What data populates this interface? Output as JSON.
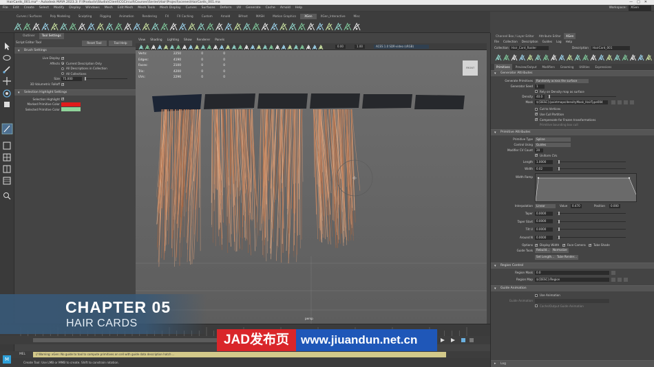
{
  "window": {
    "title": "HairCards_001.ma* - Autodesk MAYA 2023.3: F:\\Products\\Studio\\Client\\CGCircuit\\Courses\\Series\\Hair\\Project\\scenes\\HairCards_001.ma",
    "controls": [
      "—",
      "□",
      "✕"
    ]
  },
  "menubar": {
    "items": [
      "File",
      "Edit",
      "Create",
      "Select",
      "Modify",
      "Display",
      "Windows",
      "Mesh",
      "Edit Mesh",
      "Mesh Tools",
      "Mesh Display",
      "Curves",
      "Surfaces",
      "Deform",
      "UV",
      "Generate",
      "Cache",
      "Arnold",
      "Help"
    ],
    "workspace_label": "Workspace:",
    "workspace_value": "XGen"
  },
  "shelf": {
    "tabs": [
      "Curves / Surfaces",
      "Poly Modeling",
      "Sculpting",
      "Rigging",
      "Animation",
      "Rendering",
      "FX",
      "FX Caching",
      "Custom",
      "Arnold",
      "Bifrost",
      "MASH",
      "Motion Graphics",
      "XGen",
      "XGen_Interactive",
      "Misc"
    ],
    "active_tab": "XGen"
  },
  "tool_settings": {
    "tabs": [
      "Outliner",
      "Tool Settings"
    ],
    "active_tab": "Tool Settings",
    "tool_name": "Script Editor Tool",
    "reset_label": "Reset Tool",
    "help_label": "Tool Help",
    "brush_settings": "Brush Settings",
    "rows": {
      "live_display_label": "Live Display",
      "affects_label": "Affects",
      "affects_opt1": "Current Description Only",
      "affects_opt2": "All Descriptions in Collection",
      "affects_opt3": "All Collections",
      "size_label": "Size",
      "size_value": "75.000",
      "volume_label": "3D Volumetric Falloff"
    },
    "selection_highlight": "Selection Highlight Settings",
    "highlight_rows": {
      "sel_highlight_label": "Selection Highlight",
      "marked_label": "Marked Primitive Color",
      "selected_label": "Selected Primitive Color"
    }
  },
  "viewport": {
    "menu": [
      "View",
      "Shading",
      "Lighting",
      "Show",
      "Renderer",
      "Panels"
    ],
    "toolbar_values": [
      "0.00",
      "1.00"
    ],
    "color_space": "ACES 1.0 SDR-video (sRGB)",
    "hud": [
      {
        "k": "Verts:",
        "v1": "2250",
        "v2": "0",
        "v3": "0"
      },
      {
        "k": "Edges:",
        "v1": "4190",
        "v2": "0",
        "v3": "0"
      },
      {
        "k": "Faces:",
        "v1": "2100",
        "v2": "0",
        "v3": "0"
      },
      {
        "k": "Tris:",
        "v1": "4200",
        "v2": "0",
        "v3": "0"
      },
      {
        "k": "UVs:",
        "v1": "2296",
        "v2": "0",
        "v3": "0"
      }
    ],
    "viewcube_label": "FRONT",
    "camera_label": "persp"
  },
  "overlay": {
    "chapter": "CHAPTER 05",
    "subtitle": "HAIR CARDS"
  },
  "watermark": {
    "brand": "JAD发布页",
    "url": "www.jiuandun.net.cn"
  },
  "command_line": {
    "lang": "MEL",
    "result": "// Warning: xGen: No guide to tool to compute primitives on cell with guide data description hatch ..."
  },
  "help_line": {
    "text": "Create Tool: Use LMB or MMB to create. Shift to constrain rotation."
  },
  "right_panel": {
    "tabs": [
      "Channel Box / Layer Editor",
      "Attribute Editor",
      "XGen"
    ],
    "active_tab": "XGen",
    "menu": [
      "File",
      "Collection",
      "Description",
      "Guides",
      "Log",
      "Help"
    ],
    "collection_label": "Collection",
    "collection_value": "Hair_Card_Raider",
    "description_label": "Description",
    "description_value": "HairCard_001",
    "subtabs": [
      "Primitives",
      "Preview/Output",
      "Modifiers",
      "Grooming",
      "Utilities",
      "Expressions"
    ],
    "active_subtab": "Primitives",
    "generator": {
      "title": "Generator Attributes",
      "primitive_label": "Generate Primitives",
      "primitive_value": "Randomly across the surface",
      "seed_label": "Generator Seed",
      "seed_value": "1",
      "rely_text": "Rely on Density map as surface",
      "density_label": "Density",
      "density_value": "40.0",
      "mask_label": "Mask",
      "mask_value": "${DESC}/paintmaps/densityMask_HairType004",
      "cut_text": "Cut to Vertices",
      "use_text": "Use Cull Partition",
      "use_text2": "Compensate for Frozen transformations",
      "more_text": "Primitive bounding box cull"
    },
    "primitive": {
      "title": "Primitive Attributes",
      "type_label": "Primitive Type",
      "type_value": "Spline",
      "control_label": "Control Using",
      "control_value": "Guides",
      "cv_label": "Modifier CV Count",
      "cv_value": "20",
      "uniform_text": "Uniform CVs",
      "length_label": "Length",
      "length_value": "1.0000",
      "width_label": "Width",
      "width_value": "0.02",
      "ramp_label": "Width Ramp",
      "interp_label": "Interpolation",
      "interp_value": "Linear",
      "value_label": "Value",
      "value_value": "0.470",
      "pos_label": "Position",
      "pos_value": "0.000",
      "taper_label": "Taper",
      "taper_value": "0.0000",
      "taper_start_label": "Taper Start",
      "taper_start_value": "0.0000",
      "tilt_label": "Tilt U",
      "tilt_value": "0.0000",
      "around_label": "Around N",
      "around_value": "0.0000",
      "options_label": "Options",
      "options": [
        "Display Width",
        "Face Camera",
        "Tube Shade"
      ],
      "guide_tools_label": "Guide Tools",
      "guide_btn1": "Rebuild...",
      "guide_btn2": "Normalize",
      "guide_btn3": "Set Length...",
      "guide_btn4": "Tube Render..."
    },
    "region": {
      "title": "Region Control",
      "map_label": "Region Mask",
      "map_value": "0.0",
      "region_label": "Region Map",
      "region_value": "${DESC}/Region"
    },
    "cv_attrs": {
      "title": "Guide Animation",
      "use_text": "Use Animation",
      "live_label": "Guide Animation",
      "live_value": "",
      "export_text": "Cache/Output Guide Animation"
    },
    "log_label": "Log"
  }
}
